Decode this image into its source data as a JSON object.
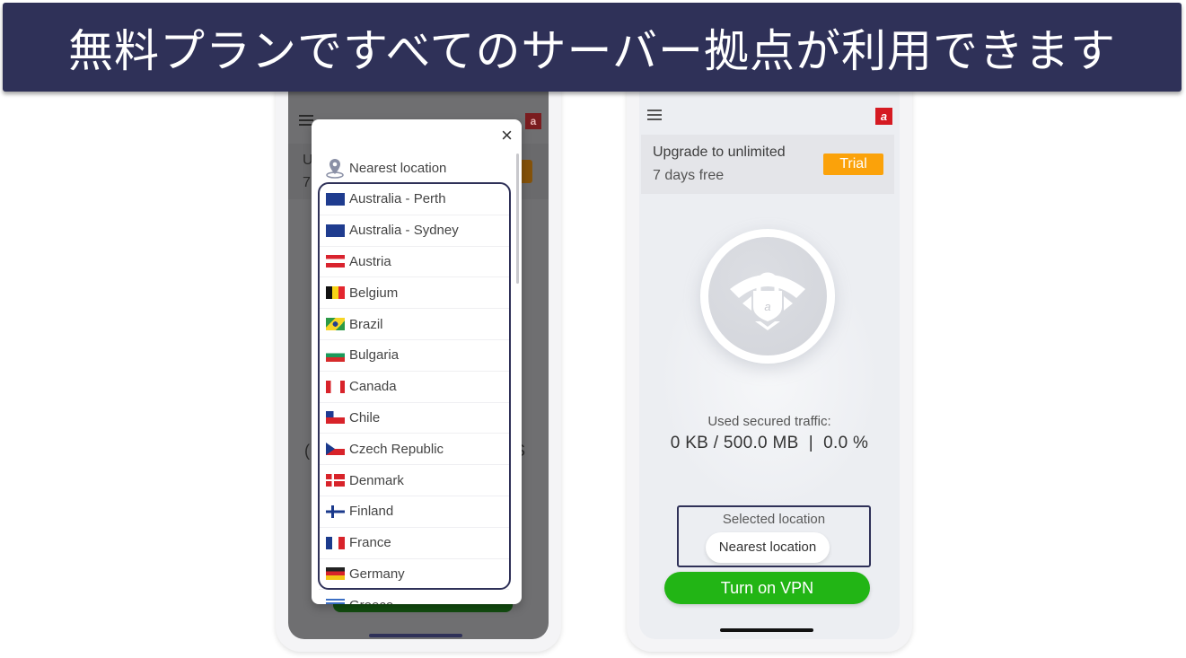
{
  "banner": {
    "title": "無料プランですべてのサーバー拠点が利用できます"
  },
  "left_phone": {
    "background": {
      "upgrade_initial": "U",
      "days_initial": "7",
      "partial_left": "(",
      "partial_right": "S"
    },
    "modal": {
      "close_icon": "×",
      "nearest_label": "Nearest location",
      "locations": [
        {
          "name": "Australia - Perth",
          "flag": "au"
        },
        {
          "name": "Australia - Sydney",
          "flag": "au"
        },
        {
          "name": "Austria",
          "flag": "at"
        },
        {
          "name": "Belgium",
          "flag": "be"
        },
        {
          "name": "Brazil",
          "flag": "br"
        },
        {
          "name": "Bulgaria",
          "flag": "bg"
        },
        {
          "name": "Canada",
          "flag": "ca"
        },
        {
          "name": "Chile",
          "flag": "cl"
        },
        {
          "name": "Czech Republic",
          "flag": "cz"
        },
        {
          "name": "Denmark",
          "flag": "dk"
        },
        {
          "name": "Finland",
          "flag": "fi"
        },
        {
          "name": "France",
          "flag": "fr"
        },
        {
          "name": "Germany",
          "flag": "de"
        },
        {
          "name": "Greece",
          "flag": "gr"
        }
      ]
    }
  },
  "right_phone": {
    "logo_glyph": "a",
    "upgrade": {
      "title": "Upgrade to unlimited",
      "subtitle": "7 days free",
      "trial_label": "Trial"
    },
    "traffic": {
      "label": "Used secured traffic:",
      "value": "0 KB / 500.0 MB  |  0.0 %"
    },
    "selected_location": {
      "label": "Selected location",
      "value": "Nearest location"
    },
    "vpn_button": "Turn on VPN"
  },
  "colors": {
    "banner_bg": "#2f3158",
    "highlight_border": "#2f3158",
    "trial_orange": "#fba20a",
    "vpn_green": "#22b515",
    "brand_red": "#d51a22"
  }
}
